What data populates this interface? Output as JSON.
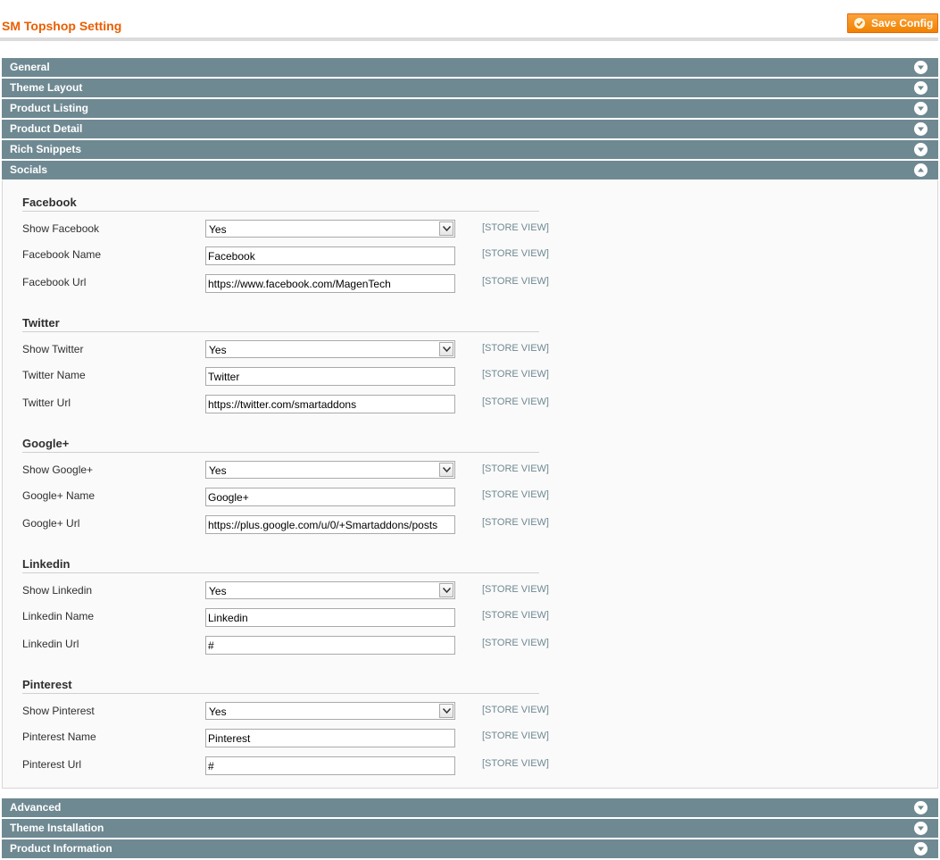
{
  "header": {
    "title": "SM Topshop Setting",
    "save_label": "Save Config",
    "accent_color": "#eb5e00"
  },
  "sections_top": [
    {
      "label": "General",
      "state": "collapsed"
    },
    {
      "label": "Theme Layout",
      "state": "collapsed"
    },
    {
      "label": "Product Listing",
      "state": "collapsed"
    },
    {
      "label": "Product Detail",
      "state": "collapsed"
    },
    {
      "label": "Rich Snippets",
      "state": "collapsed"
    },
    {
      "label": "Socials",
      "state": "expanded"
    }
  ],
  "sections_bottom": [
    {
      "label": "Advanced",
      "state": "collapsed"
    },
    {
      "label": "Theme Installation",
      "state": "collapsed"
    },
    {
      "label": "Product Information",
      "state": "collapsed"
    }
  ],
  "scope_label": "[STORE VIEW]",
  "groups": [
    {
      "title": "Facebook",
      "show_label": "Show Facebook",
      "show_value": "Yes",
      "name_label": "Facebook Name",
      "name_value": "Facebook",
      "url_label": "Facebook Url",
      "url_value": "https://www.facebook.com/MagenTech"
    },
    {
      "title": "Twitter",
      "show_label": "Show Twitter",
      "show_value": "Yes",
      "name_label": "Twitter Name",
      "name_value": "Twitter",
      "url_label": "Twitter Url",
      "url_value": "https://twitter.com/smartaddons"
    },
    {
      "title": "Google+",
      "show_label": "Show Google+",
      "show_value": "Yes",
      "name_label": "Google+ Name",
      "name_value": "Google+",
      "url_label": "Google+ Url",
      "url_value": "https://plus.google.com/u/0/+Smartaddons/posts"
    },
    {
      "title": "Linkedin",
      "show_label": "Show Linkedin",
      "show_value": "Yes",
      "name_label": "Linkedin Name",
      "name_value": "Linkedin",
      "url_label": "Linkedin Url",
      "url_value": "#"
    },
    {
      "title": "Pinterest",
      "show_label": "Show Pinterest",
      "show_value": "Yes",
      "name_label": "Pinterest Name",
      "name_value": "Pinterest",
      "url_label": "Pinterest Url",
      "url_value": "#"
    }
  ]
}
